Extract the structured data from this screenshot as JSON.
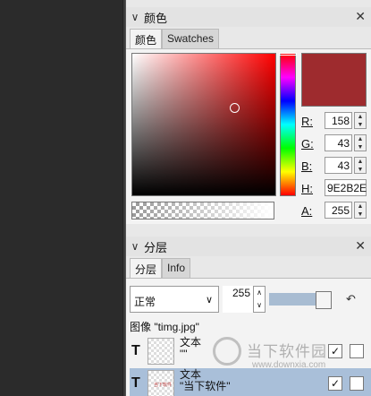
{
  "color_panel": {
    "title": "颜色",
    "tabs": [
      {
        "label": "颜色",
        "active": true
      },
      {
        "label": "Swatches",
        "active": false
      }
    ],
    "current_color": "#9E2B2E",
    "channels": {
      "r": {
        "label": "R:",
        "value": "158"
      },
      "g": {
        "label": "G:",
        "value": "43"
      },
      "b": {
        "label": "B:",
        "value": "43"
      },
      "h": {
        "label": "H:",
        "value": "9E2B2E"
      },
      "a": {
        "label": "A:",
        "value": "255"
      }
    }
  },
  "layers_panel": {
    "title": "分层",
    "tabs": [
      {
        "label": "分层",
        "active": true
      },
      {
        "label": "Info",
        "active": false
      }
    ],
    "blend_mode": "正常",
    "opacity": "255",
    "image_label": "图像 \"timg.jpg\"",
    "layers": [
      {
        "type_icon": "T",
        "name_line1": "文本",
        "name_line2": "\"\"",
        "visible": true,
        "selected": false,
        "thumb_text": ""
      },
      {
        "type_icon": "T",
        "name_line1": "文本",
        "name_line2": "\"当下软件\"",
        "visible": true,
        "selected": true,
        "thumb_text": "当下软件"
      }
    ]
  },
  "watermark": {
    "title": "当下软件园",
    "url": "www.downxia.com"
  }
}
